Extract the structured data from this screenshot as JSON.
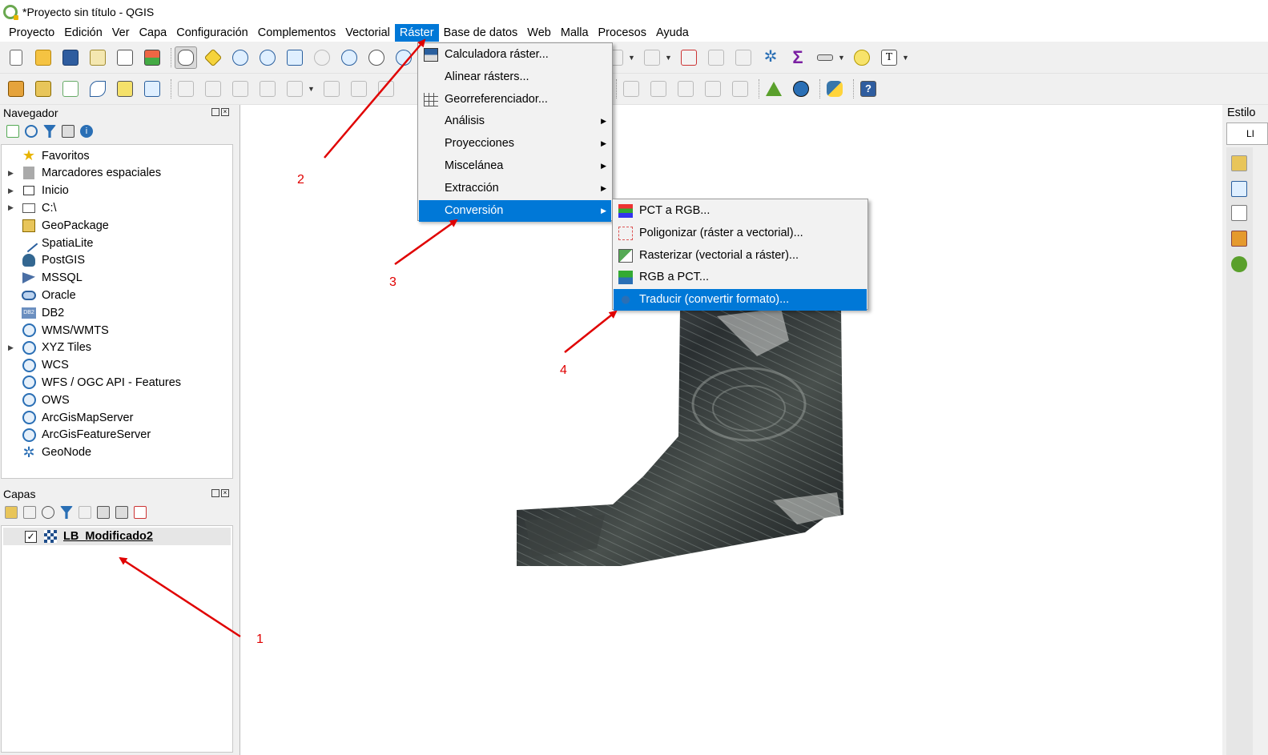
{
  "window": {
    "title": "*Proyecto sin título - QGIS"
  },
  "menubar": {
    "items": [
      "Proyecto",
      "Edición",
      "Ver",
      "Capa",
      "Configuración",
      "Complementos",
      "Vectorial",
      "Ráster",
      "Base de datos",
      "Web",
      "Malla",
      "Procesos",
      "Ayuda"
    ],
    "active": "Ráster"
  },
  "raster_menu": {
    "items": [
      {
        "label": "Calculadora ráster...",
        "icon": "calculator-icon"
      },
      {
        "label": "Alinear rásters...",
        "icon": ""
      },
      {
        "label": "Georreferenciador...",
        "icon": "grid-icon"
      },
      {
        "label": "Análisis",
        "submenu": true
      },
      {
        "label": "Proyecciones",
        "submenu": true
      },
      {
        "label": "Miscelánea",
        "submenu": true
      },
      {
        "label": "Extracción",
        "submenu": true
      },
      {
        "label": "Conversión",
        "submenu": true,
        "highlighted": true
      }
    ]
  },
  "conversion_menu": {
    "items": [
      {
        "label": "PCT a RGB...",
        "icon": "pct-to-rgb-icon"
      },
      {
        "label": "Poligonizar (ráster a vectorial)...",
        "icon": "polygonize-icon"
      },
      {
        "label": "Rasterizar (vectorial a ráster)...",
        "icon": "rasterize-icon"
      },
      {
        "label": "RGB a PCT...",
        "icon": "rgb-to-pct-icon"
      },
      {
        "label": "Traducir (convertir formato)...",
        "icon": "translate-icon",
        "highlighted": true
      }
    ]
  },
  "navigator": {
    "title": "Navegador",
    "items": [
      {
        "label": "Favoritos",
        "expandable": false,
        "icon": "star-icon"
      },
      {
        "label": "Marcadores espaciales",
        "expandable": true,
        "icon": "bookmark-icon"
      },
      {
        "label": "Inicio",
        "expandable": true,
        "icon": "home-icon"
      },
      {
        "label": "C:\\",
        "expandable": true,
        "icon": "folder-icon"
      },
      {
        "label": "GeoPackage",
        "expandable": false,
        "icon": "geopackage-icon"
      },
      {
        "label": "SpatiaLite",
        "expandable": false,
        "icon": "spatialite-icon"
      },
      {
        "label": "PostGIS",
        "expandable": false,
        "icon": "postgis-icon"
      },
      {
        "label": "MSSQL",
        "expandable": false,
        "icon": "mssql-icon"
      },
      {
        "label": "Oracle",
        "expandable": false,
        "icon": "oracle-icon"
      },
      {
        "label": "DB2",
        "expandable": false,
        "icon": "db2-icon"
      },
      {
        "label": "WMS/WMTS",
        "expandable": false,
        "icon": "globe-icon"
      },
      {
        "label": "XYZ Tiles",
        "expandable": true,
        "icon": "globe-icon"
      },
      {
        "label": "WCS",
        "expandable": false,
        "icon": "globe-icon"
      },
      {
        "label": "WFS / OGC API - Features",
        "expandable": false,
        "icon": "globe-icon"
      },
      {
        "label": "OWS",
        "expandable": false,
        "icon": "globe-icon"
      },
      {
        "label": "ArcGisMapServer",
        "expandable": false,
        "icon": "globe-icon"
      },
      {
        "label": "ArcGisFeatureServer",
        "expandable": false,
        "icon": "globe-icon"
      },
      {
        "label": "GeoNode",
        "expandable": false,
        "icon": "geonode-icon"
      }
    ]
  },
  "layers": {
    "title": "Capas",
    "items": [
      {
        "name": "LB_Modificado2",
        "checked": true
      }
    ]
  },
  "right_dock": {
    "title": "Estilo",
    "layer_abbrev": "LI"
  },
  "annotations": [
    "1",
    "2",
    "3",
    "4"
  ],
  "colors": {
    "highlight": "#0078d7",
    "annotation": "#e00000"
  }
}
